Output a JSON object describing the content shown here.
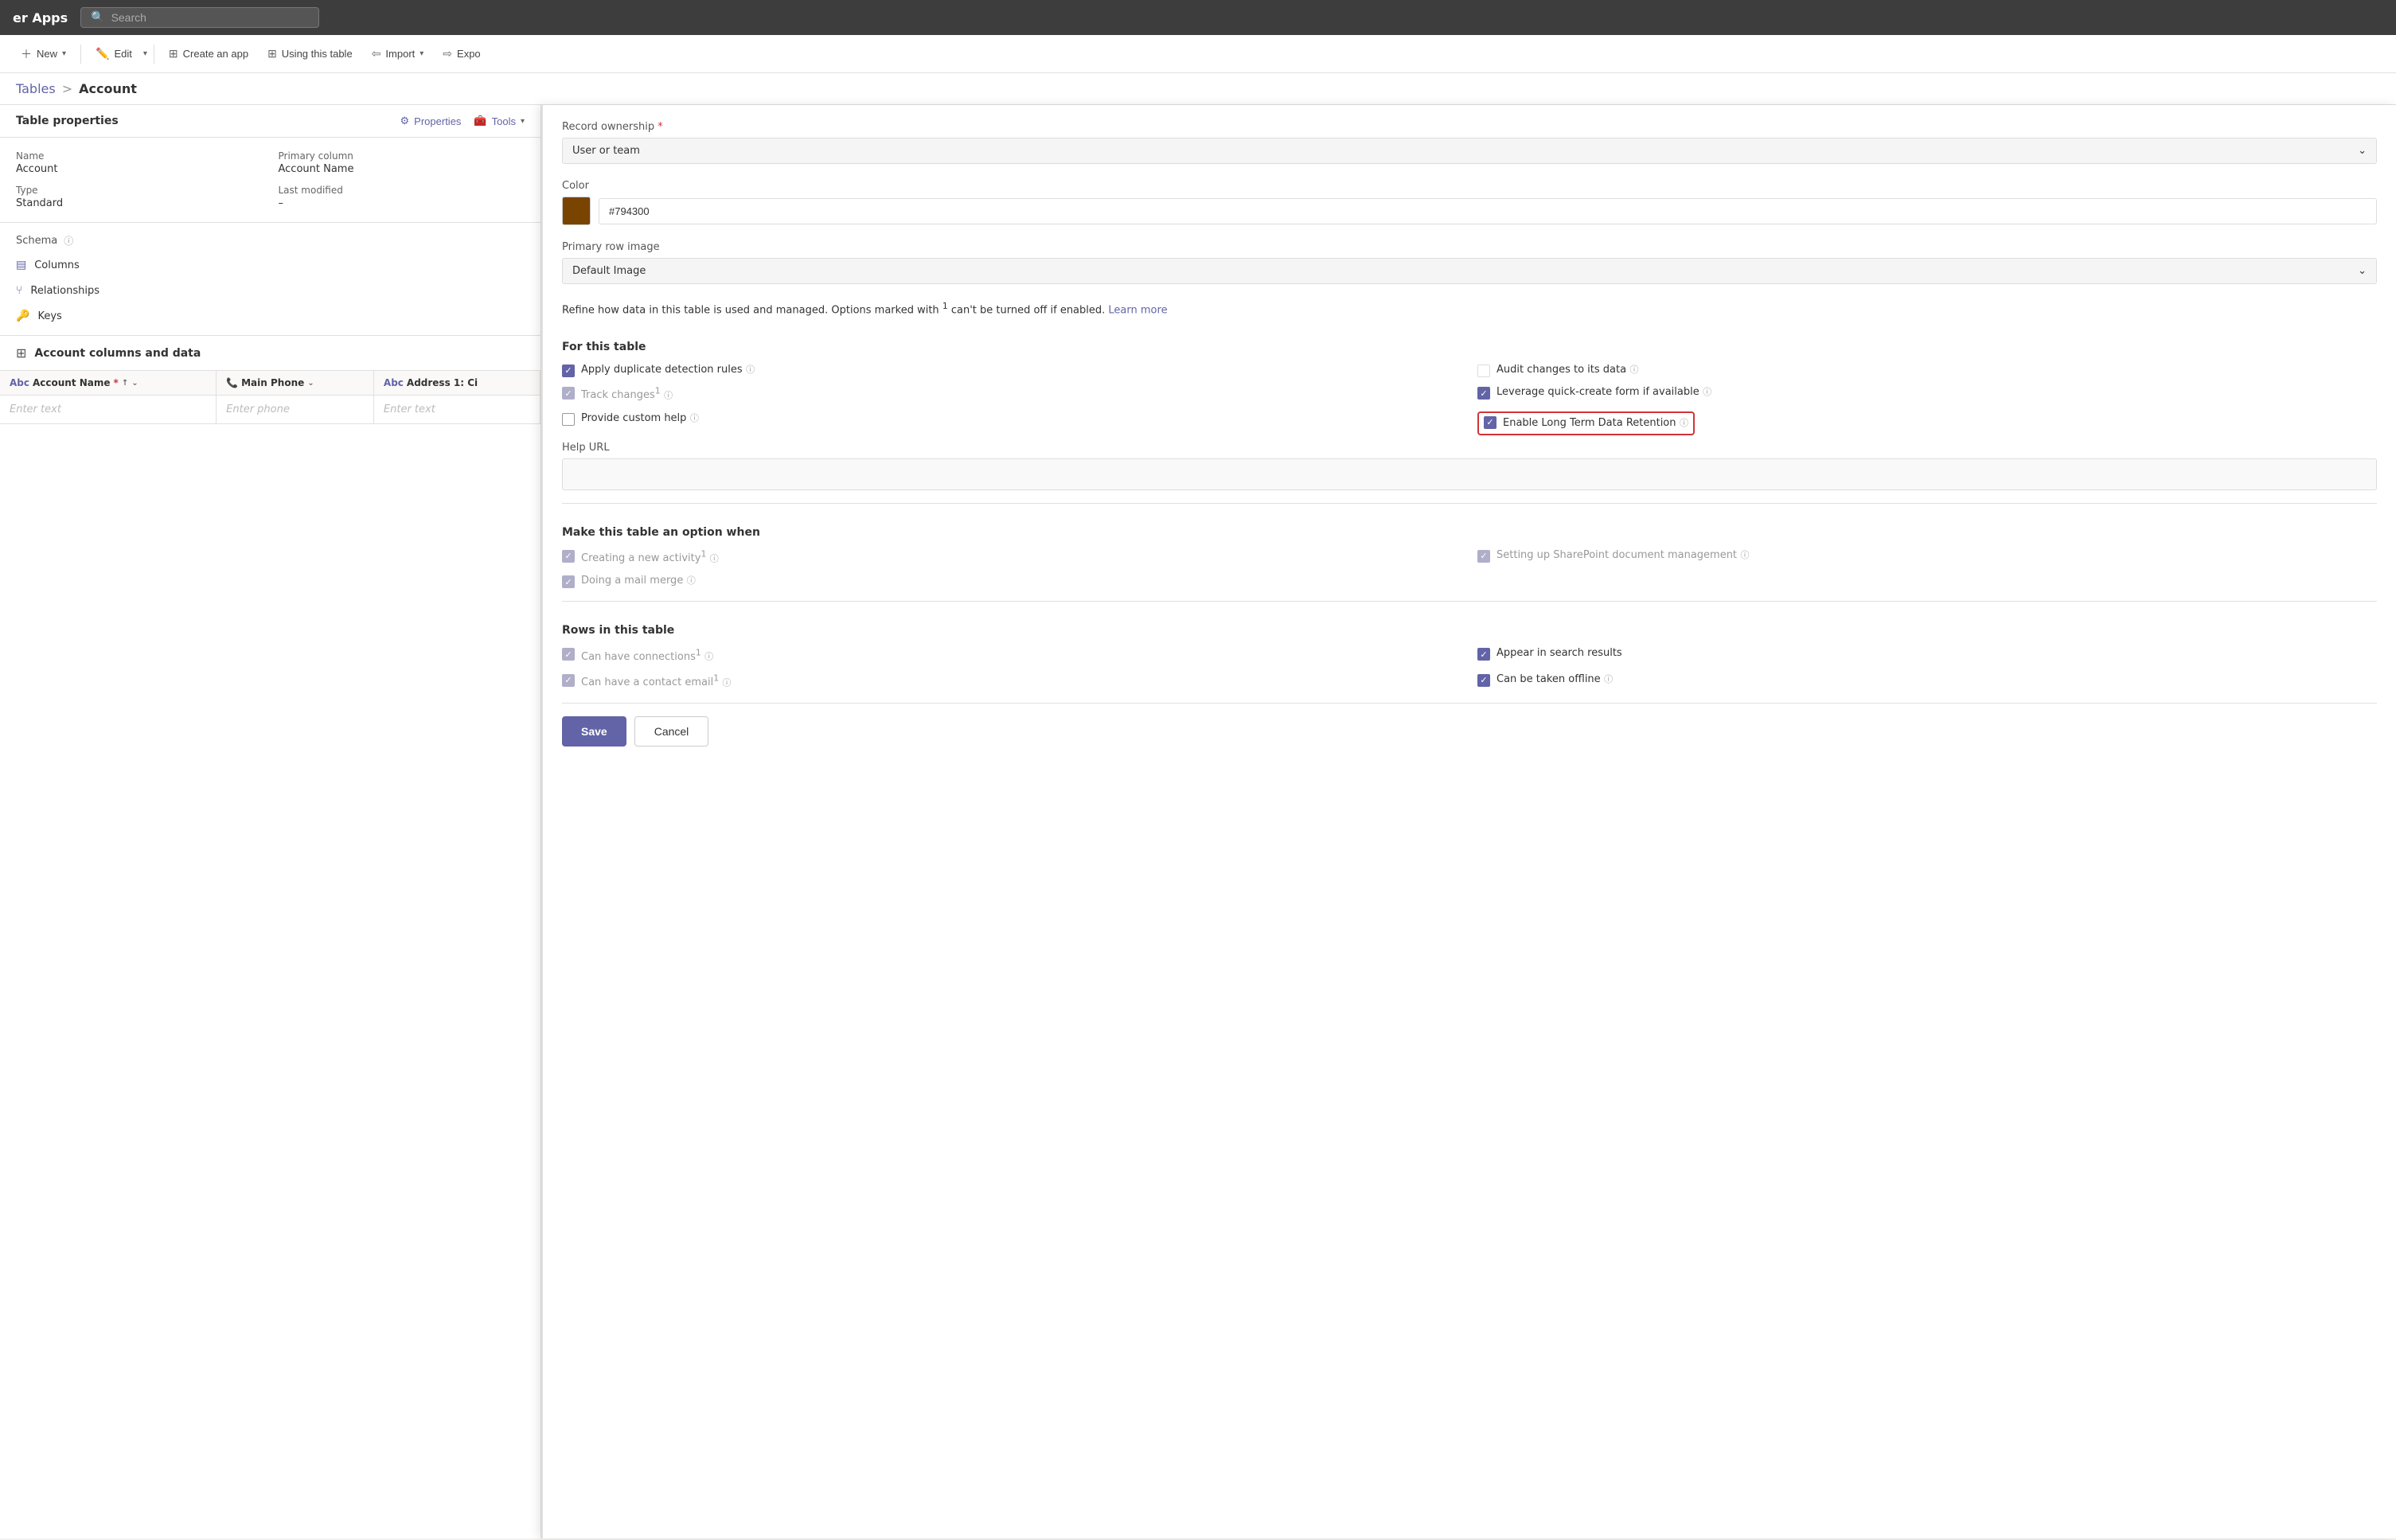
{
  "app": {
    "title": "er Apps",
    "search_placeholder": "Search"
  },
  "toolbar": {
    "new_label": "New",
    "edit_label": "Edit",
    "create_app_label": "Create an app",
    "using_table_label": "Using this table",
    "import_label": "Import",
    "export_label": "Expo"
  },
  "breadcrumb": {
    "parent": "Tables",
    "separator": ">",
    "current": "Account"
  },
  "table_properties": {
    "title": "Table properties",
    "properties_btn": "Properties",
    "tools_btn": "Tools",
    "schema_label": "Schema",
    "name_label": "Name",
    "name_value": "Account",
    "primary_column_label": "Primary column",
    "primary_column_value": "Account Name",
    "type_label": "Type",
    "type_value": "Standard",
    "last_modified_label": "Last modified",
    "last_modified_value": "–",
    "columns_nav": "Columns",
    "relationships_nav": "Relationships",
    "keys_nav": "Keys"
  },
  "account_columns": {
    "title": "Account columns and data",
    "col_account_name": "Account Name",
    "col_required_star": "*",
    "col_main_phone": "Main Phone",
    "col_address": "Address 1: Ci",
    "row_placeholder_text": "Enter text",
    "row_placeholder_phone": "Enter phone"
  },
  "properties_panel": {
    "record_ownership_label": "Record ownership",
    "record_ownership_required": "*",
    "record_ownership_value": "User or team",
    "color_label": "Color",
    "color_value": "#794300",
    "color_hex": "#794300",
    "primary_row_image_label": "Primary row image",
    "primary_row_image_value": "Default Image",
    "refine_text": "Refine how data in this table is used and managed. Options marked with",
    "refine_superscript": "1",
    "refine_text2": "can't be turned off if enabled.",
    "learn_more": "Learn more",
    "for_this_table_title": "For this table",
    "checkboxes": [
      {
        "id": "apply-duplicate",
        "label": "Apply duplicate detection rules",
        "checked": true,
        "disabled": false,
        "has_info": true
      },
      {
        "id": "audit-changes",
        "label": "Audit changes to its data",
        "checked": false,
        "disabled": false,
        "has_info": true
      },
      {
        "id": "track-changes",
        "label": "Track changes",
        "superscript": "1",
        "checked": false,
        "disabled": true,
        "has_info": true
      },
      {
        "id": "leverage-quick",
        "label": "Leverage quick-create form if available",
        "checked": true,
        "disabled": false,
        "has_info": true
      },
      {
        "id": "provide-custom",
        "label": "Provide custom help",
        "checked": false,
        "disabled": false,
        "has_info": true
      },
      {
        "id": "enable-long-term",
        "label": "Enable Long Term Data Retention",
        "checked": true,
        "disabled": false,
        "has_info": true,
        "highlighted": true
      }
    ],
    "help_url_label": "Help URL",
    "make_option_title": "Make this table an option when",
    "make_option_checkboxes": [
      {
        "id": "creating-new-activity",
        "label": "Creating a new activity",
        "superscript": "1",
        "checked": true,
        "disabled": true,
        "has_info": true
      },
      {
        "id": "setting-up-sharepoint",
        "label": "Setting up SharePoint document management",
        "checked": true,
        "disabled": true,
        "has_info": true
      },
      {
        "id": "doing-mail-merge",
        "label": "Doing a mail merge",
        "checked": true,
        "disabled": true,
        "has_info": true
      }
    ],
    "rows_title": "Rows in this table",
    "rows_checkboxes": [
      {
        "id": "can-have-connections",
        "label": "Can have connections",
        "superscript": "1",
        "checked": true,
        "disabled": true,
        "has_info": true
      },
      {
        "id": "appear-search",
        "label": "Appear in search results",
        "checked": true,
        "disabled": false,
        "has_info": false
      },
      {
        "id": "can-have-contact-email",
        "label": "Can have a contact email",
        "superscript": "1",
        "checked": true,
        "disabled": true,
        "has_info": true
      },
      {
        "id": "can-be-taken-offline",
        "label": "Can be taken offline",
        "checked": true,
        "disabled": false,
        "has_info": true
      }
    ],
    "save_label": "Save",
    "cancel_label": "Cancel"
  }
}
